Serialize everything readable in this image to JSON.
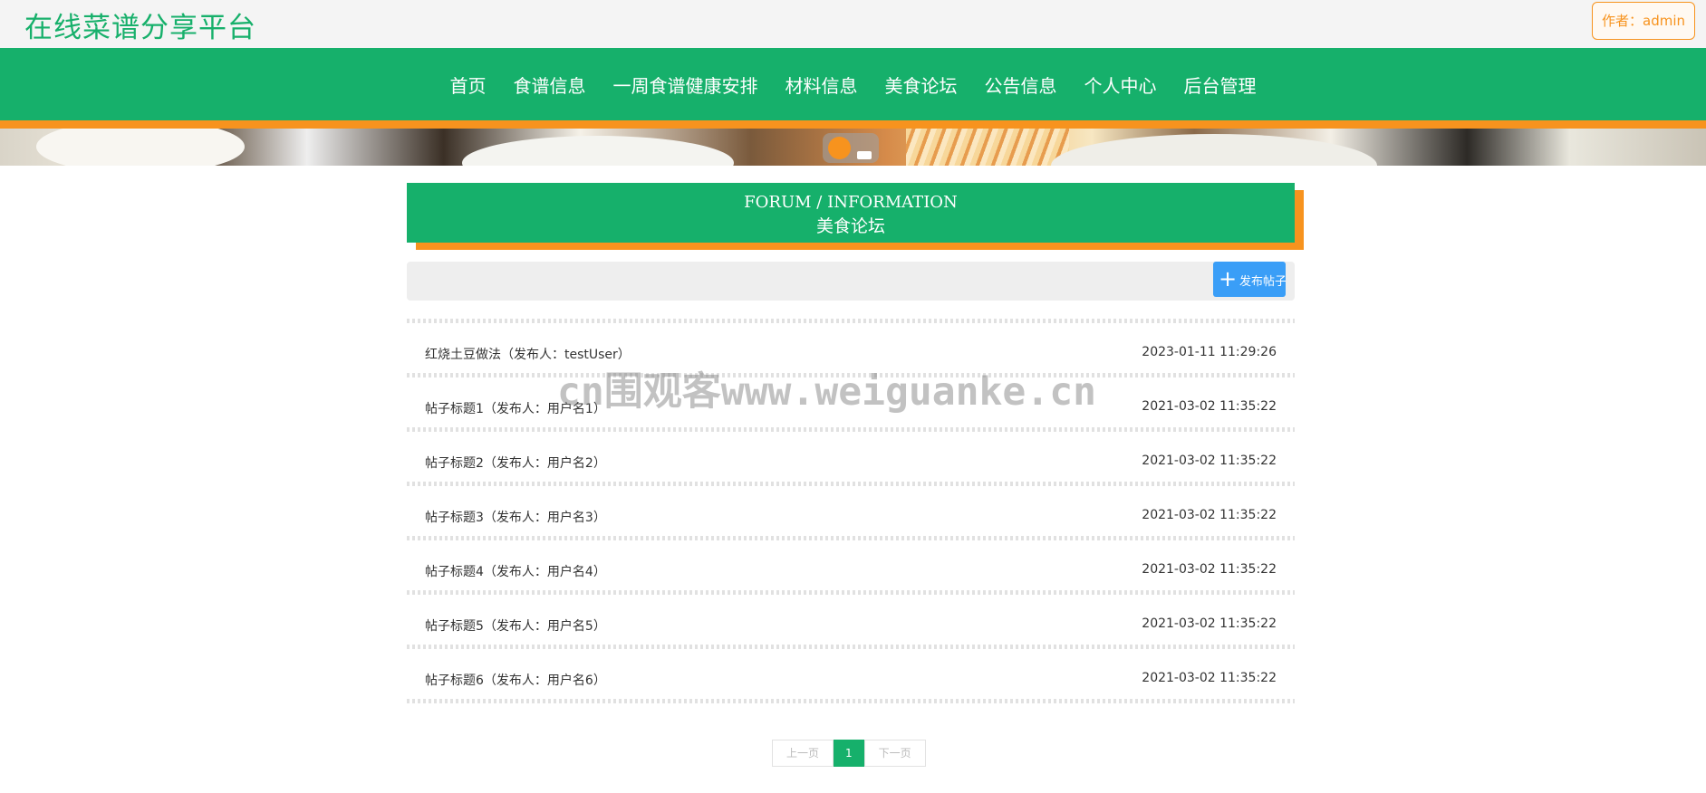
{
  "header": {
    "site_title": "在线菜谱分享平台",
    "author_label": "作者：admin"
  },
  "nav": {
    "items": [
      {
        "label": "首页"
      },
      {
        "label": "食谱信息"
      },
      {
        "label": "一周食谱健康安排"
      },
      {
        "label": "材料信息"
      },
      {
        "label": "美食论坛"
      },
      {
        "label": "公告信息"
      },
      {
        "label": "个人中心"
      },
      {
        "label": "后台管理"
      }
    ]
  },
  "section": {
    "title_en": "FORUM / INFORMATION",
    "title_cn": "美食论坛"
  },
  "toolbar": {
    "add_post_label": "发布帖子"
  },
  "posts": [
    {
      "title": "红烧土豆做法（发布人：testUser）",
      "time": "2023-01-11 11:29:26"
    },
    {
      "title": "帖子标题1（发布人：用户名1）",
      "time": "2021-03-02 11:35:22"
    },
    {
      "title": "帖子标题2（发布人：用户名2）",
      "time": "2021-03-02 11:35:22"
    },
    {
      "title": "帖子标题3（发布人：用户名3）",
      "time": "2021-03-02 11:35:22"
    },
    {
      "title": "帖子标题4（发布人：用户名4）",
      "time": "2021-03-02 11:35:22"
    },
    {
      "title": "帖子标题5（发布人：用户名5）",
      "time": "2021-03-02 11:35:22"
    },
    {
      "title": "帖子标题6（发布人：用户名6）",
      "time": "2021-03-02 11:35:22"
    }
  ],
  "pagination": {
    "prev_label": "上一页",
    "current_page": "1",
    "next_label": "下一页"
  },
  "watermark": "cn围观客www.weiguanke.cn",
  "colors": {
    "primary": "#16b06b",
    "accent": "#f7931e",
    "button_blue": "#3a9ef7"
  }
}
